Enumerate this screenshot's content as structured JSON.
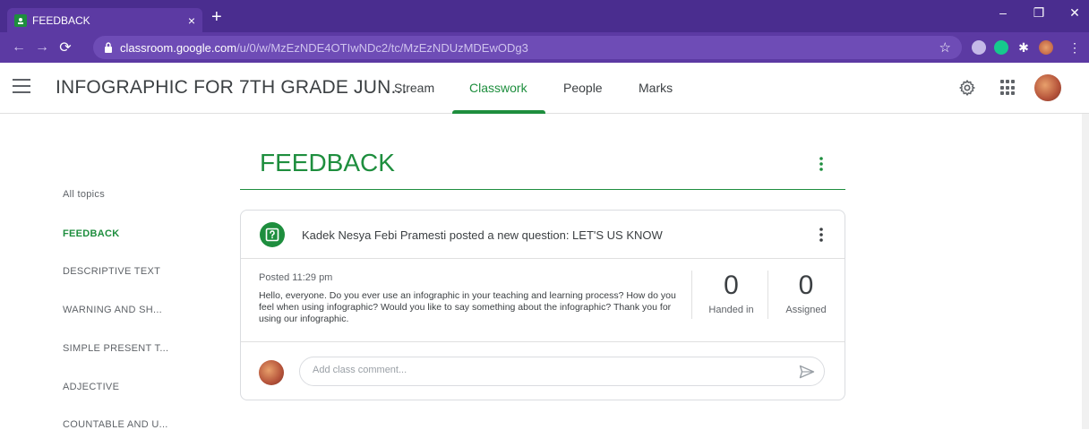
{
  "browser": {
    "tab_title": "FEEDBACK",
    "tab_close": "×",
    "new_tab": "+",
    "url_host": "classroom.google.com",
    "url_path": "/u/0/w/MzEzNDE4OTIwNDc2/tc/MzEzNDUzMDEwODg3",
    "window_controls": [
      "–",
      "❐",
      "✕"
    ],
    "accent": "#4a2d8f"
  },
  "header": {
    "class_title": "INFOGRAPHIC FOR 7TH GRADE JUN...",
    "tabs": [
      {
        "label": "Stream"
      },
      {
        "label": "Classwork"
      },
      {
        "label": "People"
      },
      {
        "label": "Marks"
      }
    ],
    "active_tab": "Classwork",
    "accent": "#1e8e3e"
  },
  "sidebar": {
    "topics": [
      {
        "label": "All topics"
      },
      {
        "label": "FEEDBACK"
      },
      {
        "label": "DESCRIPTIVE TEXT"
      },
      {
        "label": "WARNING AND SH..."
      },
      {
        "label": "SIMPLE PRESENT T..."
      },
      {
        "label": "ADJECTIVE"
      },
      {
        "label": "COUNTABLE AND U..."
      }
    ],
    "active_topic": "FEEDBACK"
  },
  "main": {
    "section_title": "FEEDBACK",
    "post": {
      "heading": "Kadek Nesya Febi Pramesti posted a new question: LET'S US KNOW",
      "posted": "Posted 11:29 pm",
      "text": "Hello, everyone. Do you ever use an infographic in your teaching and learning process? How do you feel when using infographic? Would you like to say something about the infographic? Thank you for using our infographic.",
      "handed_in_count": "0",
      "handed_in_label": "Handed in",
      "assigned_count": "0",
      "assigned_label": "Assigned",
      "comment_placeholder": "Add class comment..."
    }
  }
}
